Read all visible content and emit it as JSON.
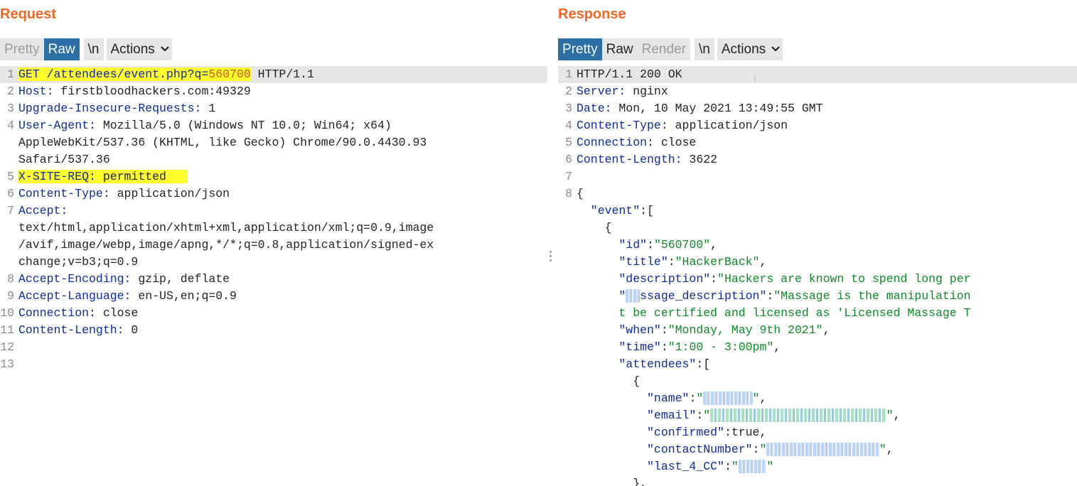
{
  "request": {
    "title": "Request",
    "toolbar": {
      "pretty": "Pretty",
      "raw": "Raw",
      "newline": "\\n",
      "actions": "Actions"
    },
    "lines": [
      {
        "n": "1",
        "parts": [
          [
            "GET /attendees/event.php?q=",
            "hk yellow"
          ],
          [
            "560700",
            "qv yellow"
          ],
          [
            " HTTP/1.1",
            "hv"
          ]
        ]
      },
      {
        "n": "2",
        "parts": [
          [
            "Host:",
            "hk"
          ],
          [
            " firstbloodhackers.com:49329",
            "hv"
          ]
        ]
      },
      {
        "n": "3",
        "parts": [
          [
            "Upgrade-Insecure-Requests:",
            "hk"
          ],
          [
            " 1",
            "hv"
          ]
        ]
      },
      {
        "n": "4",
        "parts": [
          [
            "User-Agent:",
            "hk"
          ],
          [
            " Mozilla/5.0 (Windows NT 10.0; Win64; x64)",
            "hv"
          ]
        ]
      },
      {
        "n": "",
        "parts": [
          [
            "AppleWebKit/537.36 (KHTML, like Gecko) Chrome/90.0.4430.93",
            "hv"
          ]
        ]
      },
      {
        "n": "",
        "parts": [
          [
            "Safari/537.36",
            "hv"
          ]
        ]
      },
      {
        "n": "5",
        "parts": [
          [
            "X-SITE-REQ:",
            "hk yellow"
          ],
          [
            " permitted   ",
            "hv yellow"
          ]
        ]
      },
      {
        "n": "6",
        "parts": [
          [
            "Content-Type:",
            "hk"
          ],
          [
            " application/json",
            "hv"
          ]
        ]
      },
      {
        "n": "7",
        "parts": [
          [
            "Accept:",
            "hk"
          ]
        ]
      },
      {
        "n": "",
        "parts": [
          [
            "text/html,application/xhtml+xml,application/xml;q=0.9,image",
            "hv"
          ]
        ]
      },
      {
        "n": "",
        "parts": [
          [
            "/avif,image/webp,image/apng,*/*;q=0.8,application/signed-ex",
            "hv"
          ]
        ]
      },
      {
        "n": "",
        "parts": [
          [
            "change;v=b3;q=0.9",
            "hv"
          ]
        ]
      },
      {
        "n": "8",
        "parts": [
          [
            "Accept-Encoding:",
            "hk"
          ],
          [
            " gzip, deflate",
            "hv"
          ]
        ]
      },
      {
        "n": "9",
        "parts": [
          [
            "Accept-Language:",
            "hk"
          ],
          [
            " en-US,en;q=0.9",
            "hv"
          ]
        ]
      },
      {
        "n": "10",
        "parts": [
          [
            "Connection:",
            "hk"
          ],
          [
            " close",
            "hv"
          ]
        ]
      },
      {
        "n": "11",
        "parts": [
          [
            "Content-Length:",
            "hk"
          ],
          [
            " 0",
            "hv"
          ]
        ]
      },
      {
        "n": "12",
        "parts": []
      },
      {
        "n": "13",
        "parts": []
      }
    ]
  },
  "response": {
    "title": "Response",
    "toolbar": {
      "pretty": "Pretty",
      "raw": "Raw",
      "render": "Render",
      "newline": "\\n",
      "actions": "Actions"
    },
    "lines": [
      {
        "n": "1",
        "parts": [
          [
            "HTTP/1.1 200 OK",
            "hv"
          ]
        ]
      },
      {
        "n": "2",
        "parts": [
          [
            "Server:",
            "hk"
          ],
          [
            " nginx",
            "hv"
          ]
        ]
      },
      {
        "n": "3",
        "parts": [
          [
            "Date:",
            "hk"
          ],
          [
            " Mon, 10 May 2021 13:49:55 GMT",
            "hv"
          ]
        ]
      },
      {
        "n": "4",
        "parts": [
          [
            "Content-Type:",
            "hk"
          ],
          [
            " application/json",
            "hv"
          ]
        ]
      },
      {
        "n": "5",
        "parts": [
          [
            "Connection:",
            "hk"
          ],
          [
            " close",
            "hv"
          ]
        ]
      },
      {
        "n": "6",
        "parts": [
          [
            "Content-Length:",
            "hk"
          ],
          [
            " 3622",
            "hv"
          ]
        ]
      },
      {
        "n": "7",
        "parts": []
      },
      {
        "n": "8",
        "parts": [
          [
            "{",
            "jn"
          ]
        ]
      },
      {
        "n": "",
        "parts": [
          [
            "  \"event\"",
            "jk"
          ],
          [
            ":[",
            "jn"
          ]
        ]
      },
      {
        "n": "",
        "parts": [
          [
            "    {",
            "jn"
          ]
        ]
      },
      {
        "n": "",
        "parts": [
          [
            "      \"id\"",
            "jk"
          ],
          [
            ":",
            "jn"
          ],
          [
            "\"560700\"",
            "js"
          ],
          [
            ",",
            "jn"
          ]
        ]
      },
      {
        "n": "",
        "parts": [
          [
            "      \"title\"",
            "jk"
          ],
          [
            ":",
            "jn"
          ],
          [
            "\"HackerBack\"",
            "js"
          ],
          [
            ",",
            "jn"
          ]
        ]
      },
      {
        "n": "",
        "parts": [
          [
            "      \"description\"",
            "jk"
          ],
          [
            ":",
            "jn"
          ],
          [
            "\"Hackers are known to spend long per",
            "js"
          ]
        ]
      },
      {
        "n": "",
        "parts": [
          [
            "      \"",
            "jk"
          ],
          [
            "ma",
            "jk blur"
          ],
          [
            "ssage_description\"",
            "jk"
          ],
          [
            ":",
            "jn"
          ],
          [
            "\"Massage is the manipulation",
            "js"
          ]
        ]
      },
      {
        "n": "",
        "parts": [
          [
            "      t be certified and licensed as 'Licensed Massage T",
            "js"
          ]
        ]
      },
      {
        "n": "",
        "parts": [
          [
            "      \"when\"",
            "jk"
          ],
          [
            ":",
            "jn"
          ],
          [
            "\"Monday, May 9th 2021\"",
            "js"
          ],
          [
            ",",
            "jn"
          ]
        ]
      },
      {
        "n": "",
        "parts": [
          [
            "      \"time\"",
            "jk"
          ],
          [
            ":",
            "jn"
          ],
          [
            "\"1:00 - 3:00pm\"",
            "js"
          ],
          [
            ",",
            "jn"
          ]
        ]
      },
      {
        "n": "",
        "parts": [
          [
            "      \"attendees\"",
            "jk"
          ],
          [
            ":[",
            "jn"
          ]
        ]
      },
      {
        "n": "",
        "parts": [
          [
            "        {",
            "jn"
          ]
        ]
      },
      {
        "n": "",
        "parts": [
          [
            "          \"name\"",
            "jk"
          ],
          [
            ":",
            "jn"
          ],
          [
            "\"",
            "js"
          ],
          [
            "XXXXX X",
            "js blur"
          ],
          [
            "\"",
            "js"
          ],
          [
            ",",
            "jn"
          ]
        ]
      },
      {
        "n": "",
        "parts": [
          [
            "          \"email\"",
            "jk"
          ],
          [
            ":",
            "jn"
          ],
          [
            "\"",
            "js"
          ],
          [
            "XXXXXXXXXXXXXXXXXXXXXXXXX",
            "js blur green"
          ],
          [
            "\"",
            "js"
          ],
          [
            ",",
            "jn"
          ]
        ]
      },
      {
        "n": "",
        "parts": [
          [
            "          \"confirmed\"",
            "jk"
          ],
          [
            ":true,",
            "jn"
          ]
        ]
      },
      {
        "n": "",
        "parts": [
          [
            "          \"contactNumber\"",
            "jk"
          ],
          [
            ":",
            "jn"
          ],
          [
            "\"",
            "js"
          ],
          [
            "XXX XXX XXX XXXX",
            "js blur"
          ],
          [
            "\"",
            "js"
          ],
          [
            ",",
            "jn"
          ]
        ]
      },
      {
        "n": "",
        "parts": [
          [
            "          \"last_4_CC\"",
            "jk"
          ],
          [
            ":",
            "jn"
          ],
          [
            "\"",
            "js"
          ],
          [
            "XXXX",
            "js blur"
          ],
          [
            "\"",
            "js"
          ]
        ]
      },
      {
        "n": "",
        "parts": [
          [
            "        },",
            "jn"
          ]
        ]
      }
    ]
  },
  "colors": {
    "accent": "#f26522",
    "active_button": "#2c6ea6",
    "highlight": "#ffff2e",
    "key": "#0f2a9e",
    "string": "#0d8a2a"
  },
  "icons": {
    "actions_dropdown": "chevron-down-icon",
    "divider": "vertical-dots-icon",
    "cursor": "text-cursor-icon"
  }
}
